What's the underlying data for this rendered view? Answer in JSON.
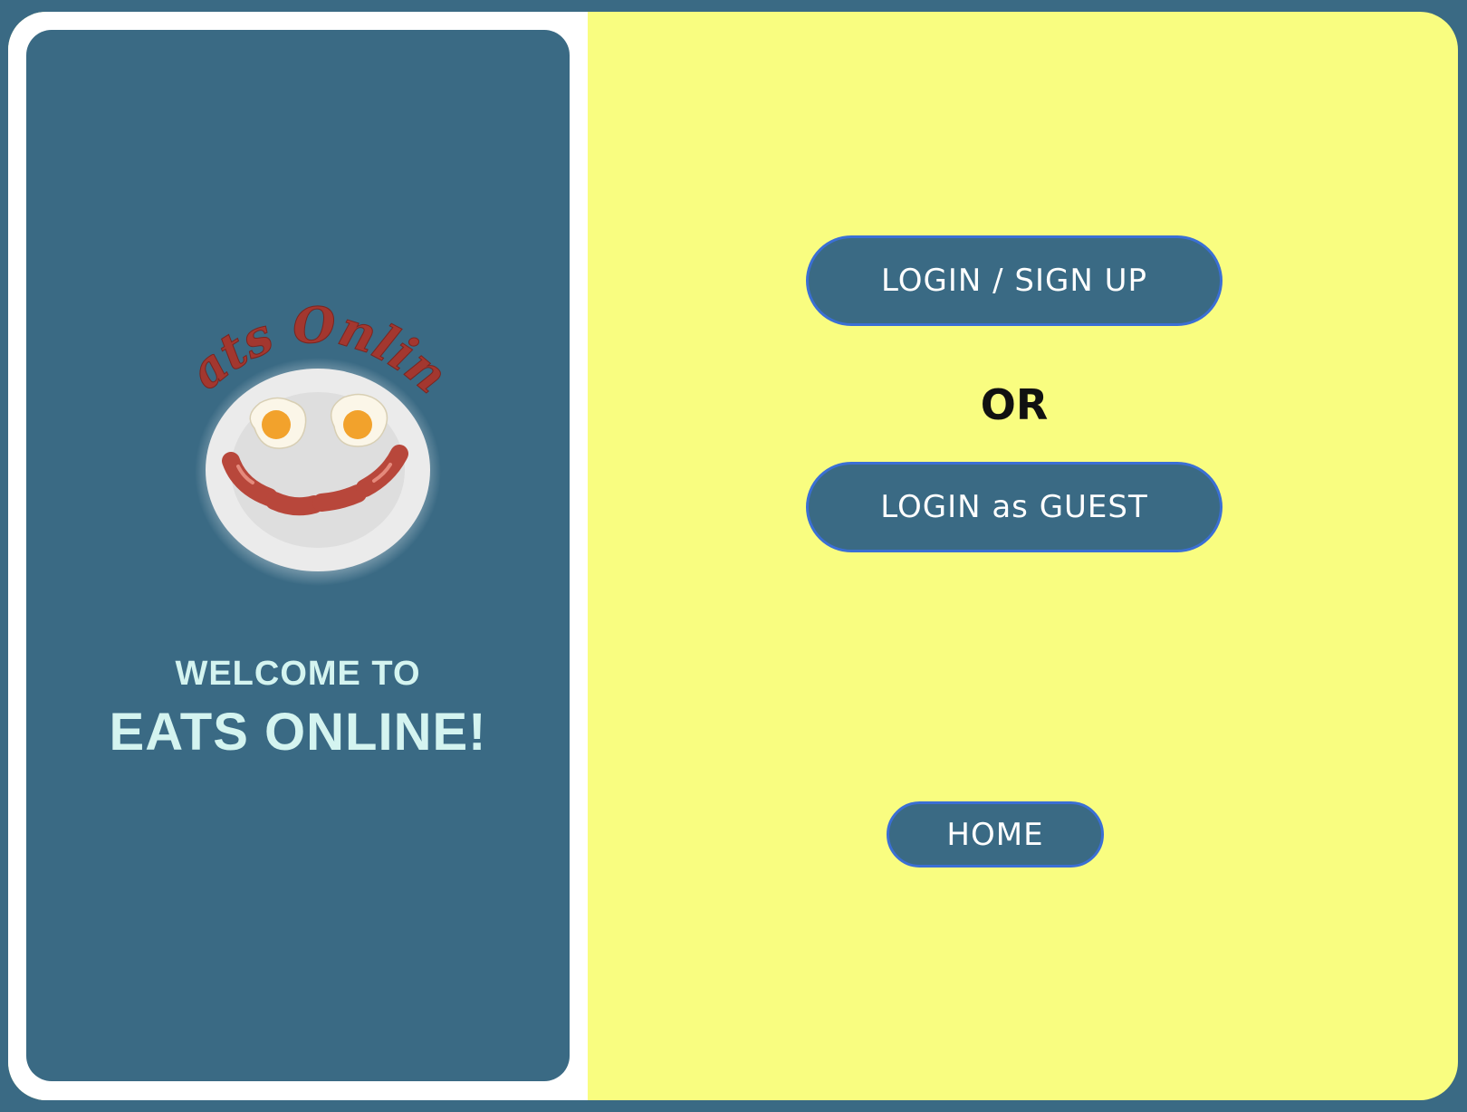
{
  "brand": {
    "logo_text": "Eats Online",
    "welcome_line1": "WELCOME TO",
    "welcome_line2": "EATS ONLINE!"
  },
  "auth": {
    "login_signup_label": "LOGIN / SIGN UP",
    "or_label": "OR",
    "guest_label": "LOGIN as GUEST"
  },
  "nav": {
    "home_label": "HOME"
  },
  "colors": {
    "background": "#3a6a84",
    "right_panel": "#f9fd80",
    "button_fill": "#3a6a84",
    "button_border": "#3b6fd4",
    "welcome_text": "#d4f4f0"
  },
  "icons": {
    "logo": "smiley-breakfast-plate-logo"
  }
}
